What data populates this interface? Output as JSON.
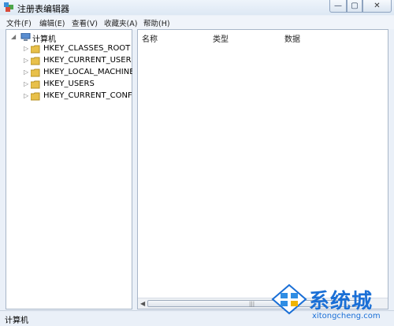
{
  "window": {
    "title": "注册表编辑器",
    "status": "计算机"
  },
  "caption_buttons": {
    "minimize": "—",
    "maximize": "▢",
    "close": "✕"
  },
  "menu": [
    {
      "label": "文件(F)"
    },
    {
      "label": "编辑(E)"
    },
    {
      "label": "查看(V)"
    },
    {
      "label": "收藏夹(A)"
    },
    {
      "label": "帮助(H)"
    }
  ],
  "tree": {
    "root": "计算机",
    "items": [
      {
        "label": "HKEY_CLASSES_ROOT"
      },
      {
        "label": "HKEY_CURRENT_USER"
      },
      {
        "label": "HKEY_LOCAL_MACHINE"
      },
      {
        "label": "HKEY_USERS"
      },
      {
        "label": "HKEY_CURRENT_CONFIG"
      }
    ]
  },
  "list": {
    "columns": [
      "名称",
      "类型",
      "数据"
    ]
  },
  "watermark": {
    "cn": "系统城",
    "en": "xitongcheng.com"
  },
  "colors": {
    "folder": "#e8c04a",
    "accent": "#1a6fd6"
  }
}
